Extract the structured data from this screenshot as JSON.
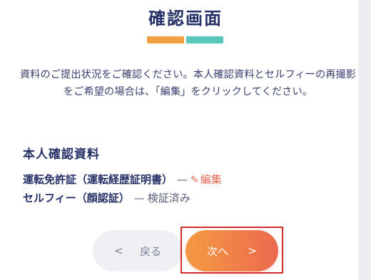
{
  "page": {
    "title": "確認画面",
    "intro": "資料のご提出状況をご確認ください。本人確認資料とセルフィーの再撮影をご希望の場合は、「編集」をクリックしてください。"
  },
  "section": {
    "heading": "本人確認資料"
  },
  "documents": [
    {
      "name": "運転免許証（運転経歴証明書）",
      "separator": "—",
      "action_label": "編集",
      "action_icon": "pencil-icon"
    },
    {
      "name": "セルフィー（顔認証）",
      "separator": "—",
      "status": "検証済み"
    }
  ],
  "buttons": {
    "back": {
      "chevron": "<",
      "label": "戻る"
    },
    "next": {
      "label": "次へ",
      "chevron": ">"
    }
  },
  "colors": {
    "title": "#253066",
    "bar_orange": "#f3a040",
    "bar_teal": "#57c7be",
    "edit_link": "#e86857",
    "next_gradient_start": "#f39a42",
    "next_gradient_end": "#ee6a4f",
    "focus_box": "#d42a2a"
  }
}
